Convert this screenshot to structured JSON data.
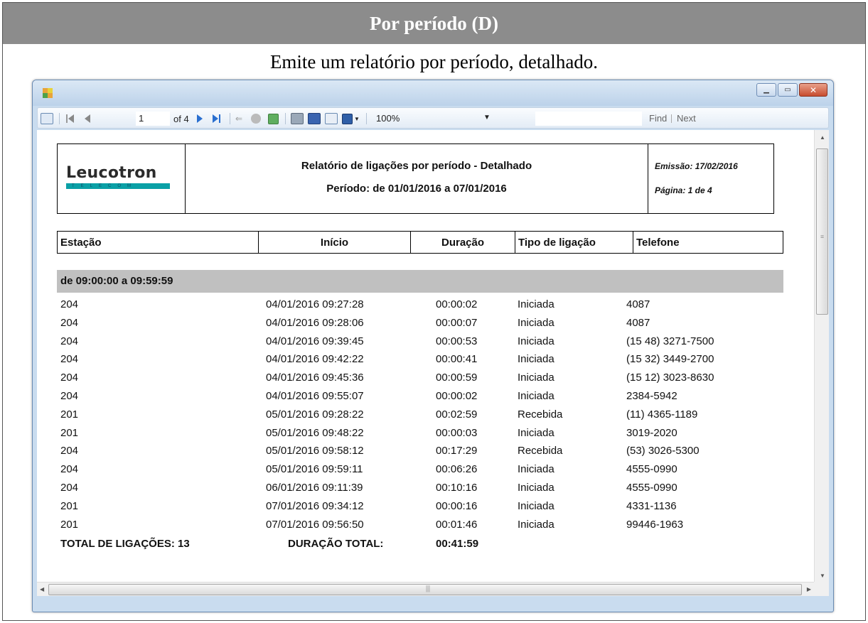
{
  "document": {
    "header": "Por período (D)",
    "subtitle": "Emite um relatório por período, detalhado."
  },
  "toolbar": {
    "page_current": "1",
    "page_of": "of 4",
    "zoom": "100%",
    "find_label": "Find",
    "next_label": "Next"
  },
  "report": {
    "logo_text": "Leucotron",
    "logo_subtext": "TELECOM",
    "title": "Relatório de ligações por período - Detalhado",
    "period": "Período: de 01/01/2016 a 07/01/2016",
    "emission": "Emissão: 17/02/2016",
    "page": "Página: 1 de 4",
    "columns": [
      "Estação",
      "Início",
      "Duração",
      "Tipo de ligação",
      "Telefone"
    ],
    "group_label": "de 09:00:00 a 09:59:59",
    "rows": [
      {
        "estacao": "204",
        "inicio": "04/01/2016 09:27:28",
        "duracao": "00:00:02",
        "tipo": "Iniciada",
        "telefone": "4087"
      },
      {
        "estacao": "204",
        "inicio": "04/01/2016 09:28:06",
        "duracao": "00:00:07",
        "tipo": "Iniciada",
        "telefone": "4087"
      },
      {
        "estacao": "204",
        "inicio": "04/01/2016 09:39:45",
        "duracao": "00:00:53",
        "tipo": "Iniciada",
        "telefone": "(15 48) 3271-7500"
      },
      {
        "estacao": "204",
        "inicio": "04/01/2016 09:42:22",
        "duracao": "00:00:41",
        "tipo": "Iniciada",
        "telefone": "(15 32) 3449-2700"
      },
      {
        "estacao": "204",
        "inicio": "04/01/2016 09:45:36",
        "duracao": "00:00:59",
        "tipo": "Iniciada",
        "telefone": "(15 12) 3023-8630"
      },
      {
        "estacao": "204",
        "inicio": "04/01/2016 09:55:07",
        "duracao": "00:00:02",
        "tipo": "Iniciada",
        "telefone": "2384-5942"
      },
      {
        "estacao": "201",
        "inicio": "05/01/2016 09:28:22",
        "duracao": "00:02:59",
        "tipo": "Recebida",
        "telefone": "(11) 4365-1189"
      },
      {
        "estacao": "201",
        "inicio": "05/01/2016 09:48:22",
        "duracao": "00:00:03",
        "tipo": "Iniciada",
        "telefone": "3019-2020"
      },
      {
        "estacao": "204",
        "inicio": "05/01/2016 09:58:12",
        "duracao": "00:17:29",
        "tipo": "Recebida",
        "telefone": "(53) 3026-5300"
      },
      {
        "estacao": "204",
        "inicio": "05/01/2016 09:59:11",
        "duracao": "00:06:26",
        "tipo": "Iniciada",
        "telefone": "4555-0990"
      },
      {
        "estacao": "204",
        "inicio": "06/01/2016 09:11:39",
        "duracao": "00:10:16",
        "tipo": "Iniciada",
        "telefone": "4555-0990"
      },
      {
        "estacao": "201",
        "inicio": "07/01/2016 09:34:12",
        "duracao": "00:00:16",
        "tipo": "Iniciada",
        "telefone": "4331-1136"
      },
      {
        "estacao": "201",
        "inicio": "07/01/2016 09:56:50",
        "duracao": "00:01:46",
        "tipo": "Iniciada",
        "telefone": "99446-1963"
      }
    ],
    "total_calls_label": "TOTAL DE LIGAÇÕES: 13",
    "total_duration_label": "DURAÇÃO TOTAL:",
    "total_duration_value": "00:41:59"
  }
}
